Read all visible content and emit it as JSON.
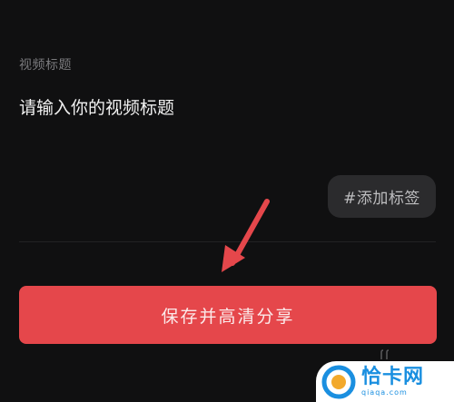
{
  "form": {
    "section_label": "视频标题",
    "title_placeholder": "请输入你的视频标题",
    "tag_label": "#添加标签"
  },
  "actions": {
    "save_share_label": "保存并高清分享"
  },
  "watermark": {
    "brand": "恰卡网",
    "url": "qiaqa.com"
  },
  "colors": {
    "background": "#101011",
    "primary_button": "#e5474b",
    "annotation_arrow": "#e5474b",
    "tag_chip": "#2b2b2d",
    "watermark_accent": "#1a8fe0"
  }
}
